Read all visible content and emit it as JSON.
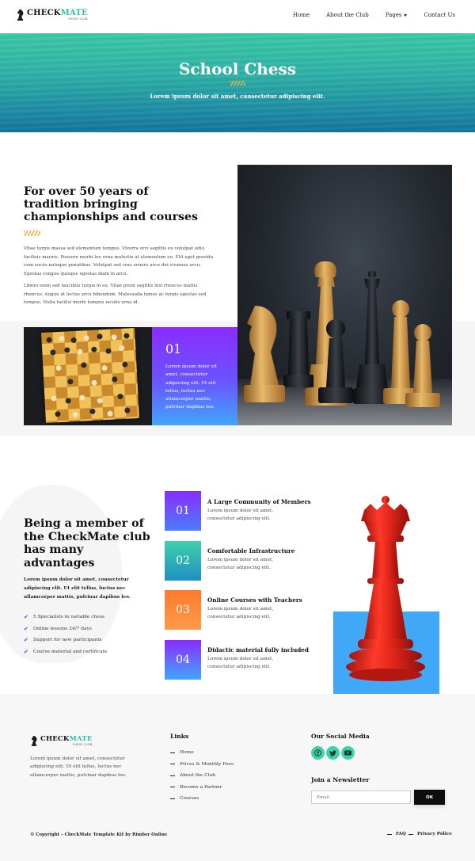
{
  "header": {
    "logo": {
      "title_main": "CHECK",
      "title_accent": "MATE",
      "subtitle": "CHESS CLUB"
    },
    "nav": [
      {
        "label": "Home"
      },
      {
        "label": "About the Club"
      },
      {
        "label": "Pages",
        "has_dropdown": true
      },
      {
        "label": "Contact Us"
      }
    ]
  },
  "hero": {
    "title": "School Chess",
    "subtitle": "Lorem ipsum dolor sit amet, consectetur adipiscing elit."
  },
  "tradition": {
    "title": "For over 50 years of tradition bringing championships and courses",
    "paragraph1": "Vitae turpis massa sed elementum tempus. Viverra orci sagittis eu volutpat odio facilisis mauris. Posuere morbi leo urna molestie at elementum eu. Elit eget gravida cum sociis natoque penatibus. Volutpat sed cras ornare arcu dui vivamus arcu. Egestas congue quisque egestas diam in arcu.",
    "paragraph2": "Libero enim sed faucibus turpis in eu. Vitae proin sagittis nisl rhoncus mattis rhoncus. Augue ut lectus arcu bibendum. Malesuada fames ac turpis egestas sed tempus. Nulla facilisi morbi tempus iaculis urna id.",
    "card": {
      "number": "01",
      "text": "Lorem ipsum dolor sit amet, consectetur adipiscing elit. Ut elit tellus, luctus nec ullamcorper mattis, pulvinar dapibus leo."
    }
  },
  "advantages": {
    "title": "Being a member of the CheckMate club has many advantages",
    "lead": "Lorem ipsum dolor sit amet, consectetur adipiscing elit. Ut elit tellus, luctus nec ullamcorper mattis, pulvinar dapibus leo.",
    "checklist": [
      "5 Specialists in variable chess",
      "Online lessons 24/7 days",
      "Support for new participants",
      "Course material and certificate"
    ],
    "features": [
      {
        "number": "01",
        "title": "A Large Community of Members",
        "text": "Lorem ipsum dolor sit amet, consectetur adipiscing elit."
      },
      {
        "number": "02",
        "title": "Comfortable Infrastructure",
        "text": "Lorem ipsum dolor sit amet, consectetur adipiscing elit."
      },
      {
        "number": "03",
        "title": "Online Courses with Teachers",
        "text": "Lorem ipsum dolor sit amet, consectetur adipiscing elit."
      },
      {
        "number": "04",
        "title": "Didactic material fully included",
        "text": "Lorem ipsum dolor sit amet, consectetur adipiscing elit."
      }
    ]
  },
  "footer": {
    "logo": {
      "title_main": "CHECK",
      "title_accent": "MATE",
      "subtitle": "CHESS CLUB"
    },
    "about": "Lorem ipsum dolor sit amet, consectetur adipiscing elit. Ut elit tellus, luctus nec ullamcorper mattis, pulvinar dapibus leo.",
    "links_heading": "Links",
    "links": [
      "Home",
      "Prices & Monthly Fees",
      "About the Club",
      "Become a Partner",
      "Courses"
    ],
    "social_heading": "Our Social Media",
    "social_icons": [
      "facebook-icon",
      "twitter-icon",
      "youtube-icon"
    ],
    "newsletter_heading": "Join a Newsletter",
    "email_placeholder": "Email",
    "ok_label": "OK",
    "copyright": "© Copyright – CheckMate Template Kit by Rimber Online",
    "legal_links": [
      "FAQ",
      "Privacy Police"
    ]
  },
  "colors": {
    "accent_teal": "#3fd1a9",
    "accent_purple": "#7a2bff",
    "accent_blue": "#41a8f8",
    "accent_orange": "#ff7a2b",
    "deco_gold": "#e6b347"
  }
}
